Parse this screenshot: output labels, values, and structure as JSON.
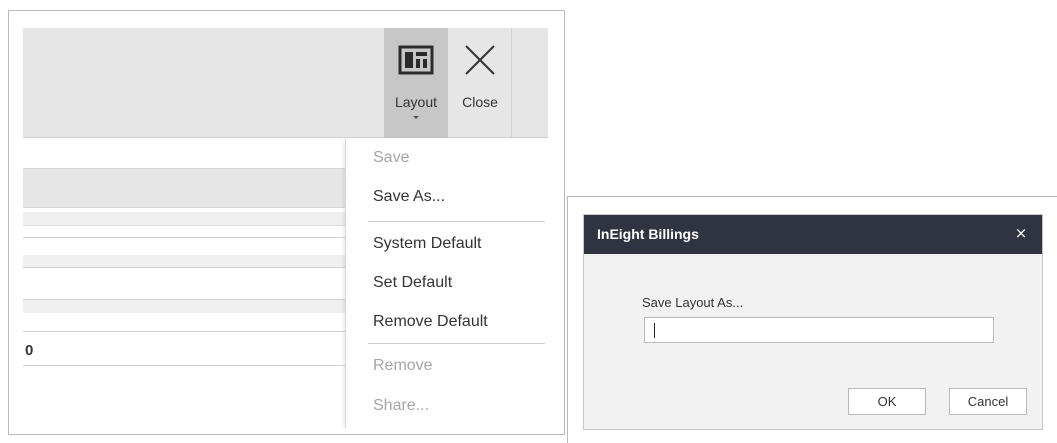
{
  "ribbon": {
    "layout_label": "Layout",
    "close_label": "Close",
    "layout_icon": "layout-grid-icon",
    "close_icon": "close-x-icon"
  },
  "layout_menu": {
    "items": [
      {
        "label": "Save",
        "enabled": false
      },
      {
        "label": "Save As...",
        "enabled": true
      },
      {
        "label": "System Default",
        "enabled": true
      },
      {
        "label": "Set Default",
        "enabled": true
      },
      {
        "label": "Remove Default",
        "enabled": true
      },
      {
        "label": "Remove",
        "enabled": false
      },
      {
        "label": "Share...",
        "enabled": false
      }
    ]
  },
  "grid": {
    "row_value": "0"
  },
  "dialog": {
    "title": "InEight Billings",
    "close_glyph": "×",
    "field_label": "Save Layout As...",
    "field_value": "",
    "ok_label": "OK",
    "cancel_label": "Cancel"
  },
  "colors": {
    "titlebar": "#2f3440",
    "ribbon_bg": "#e6e6e6",
    "ribbon_active": "#c7c7c7",
    "disabled_text": "#a6a6a6"
  }
}
